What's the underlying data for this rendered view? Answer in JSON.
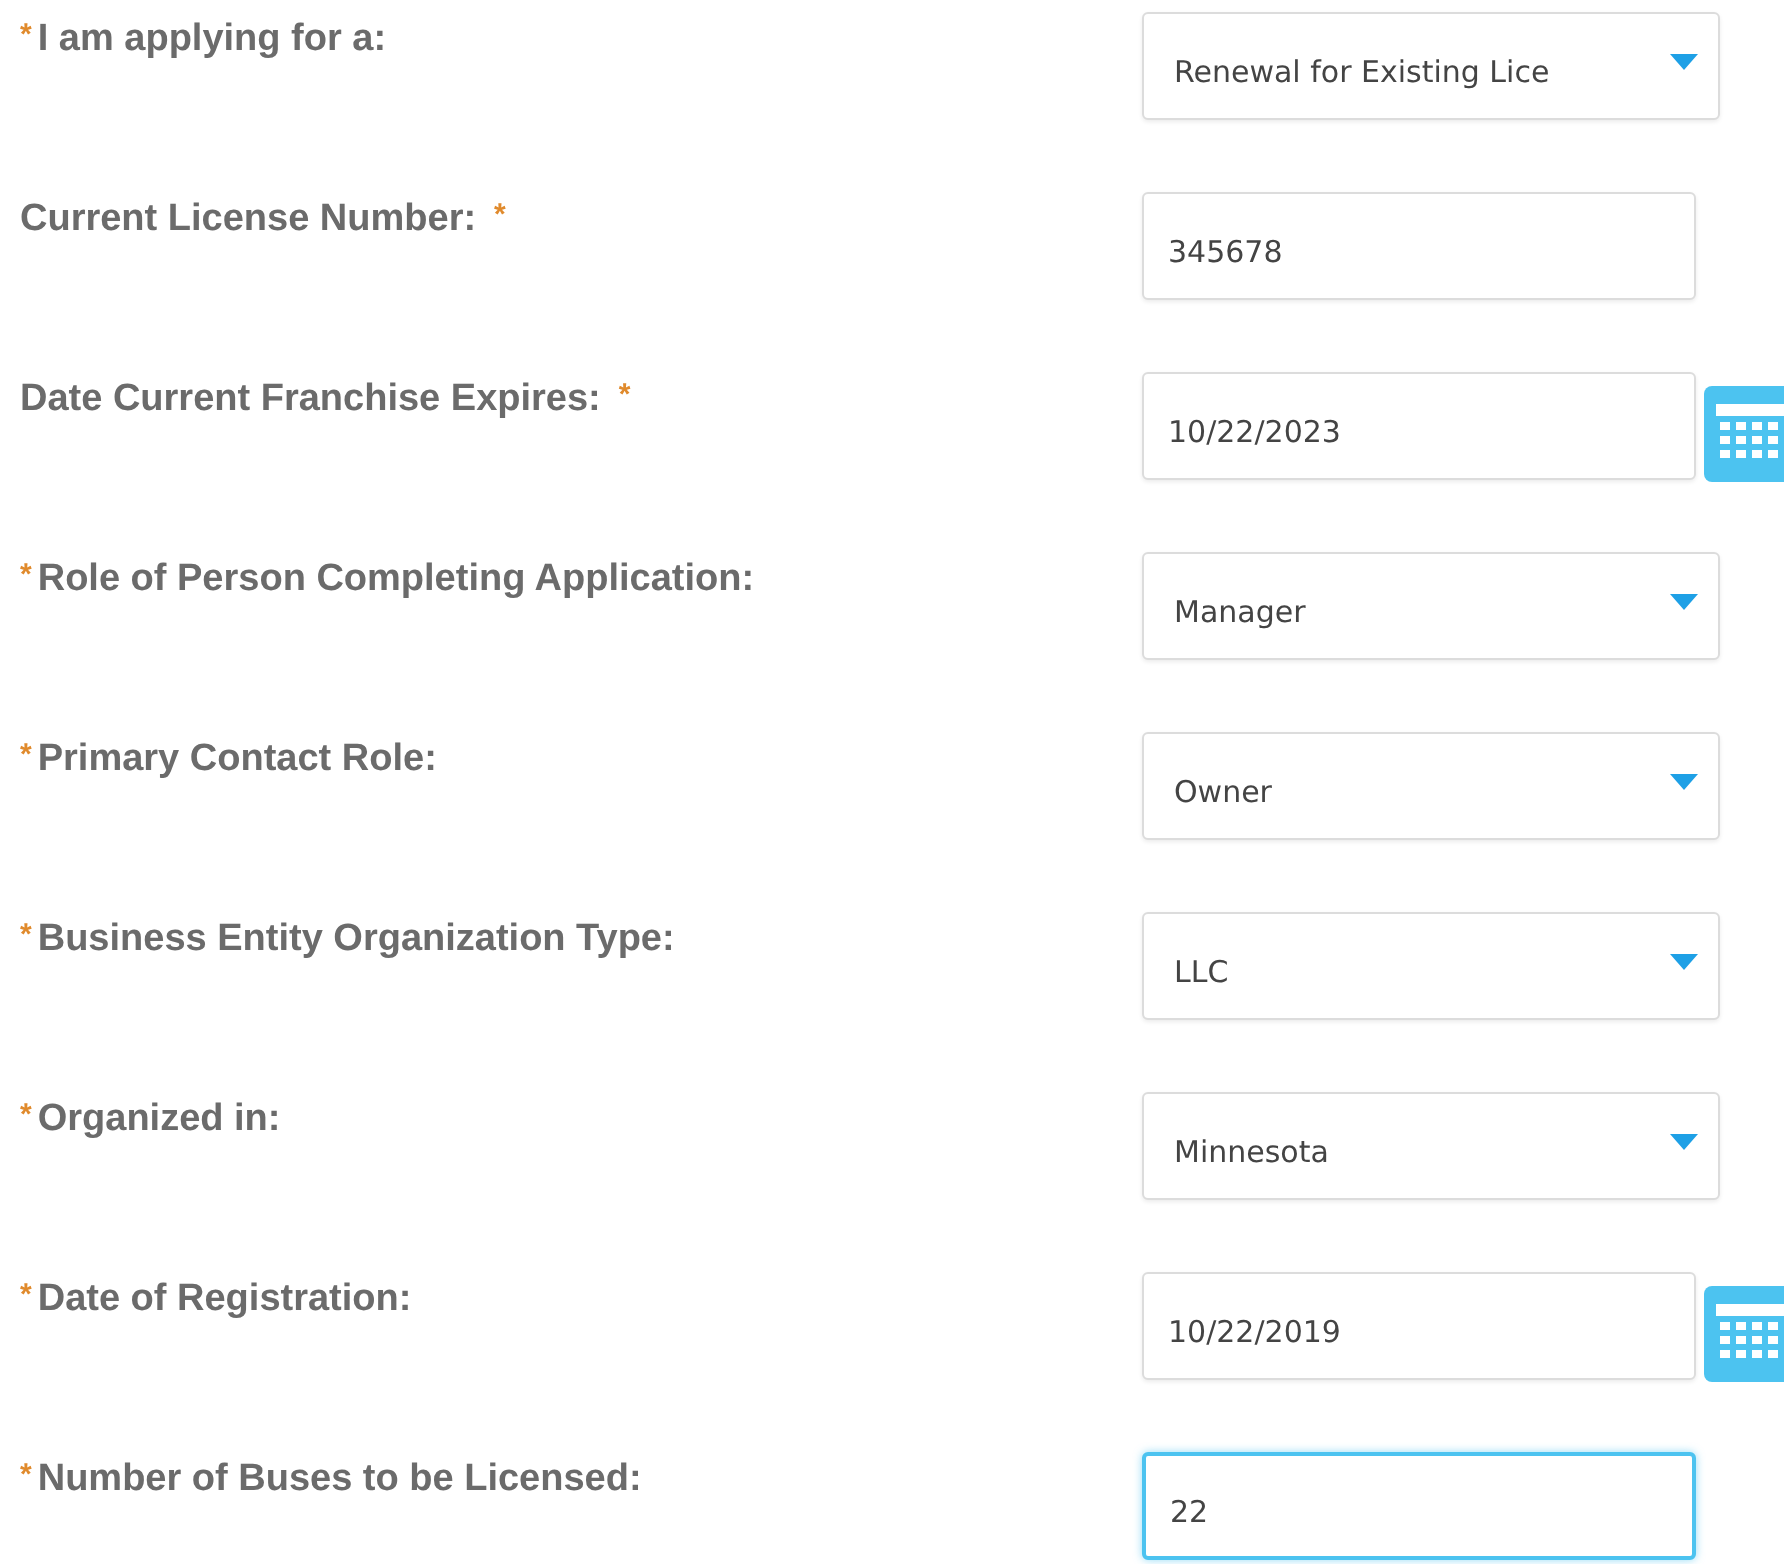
{
  "fields": [
    {
      "label_parts": [
        {
          "kind": "mark",
          "text": "*"
        },
        {
          "kind": "label",
          "text": "I am applying for a:"
        }
      ],
      "kind": "select",
      "value": "Renewal for Existing Lice",
      "focused": false
    },
    {
      "label_parts": [
        {
          "kind": "label",
          "text": "Current License Number:"
        },
        {
          "kind": "mark",
          "text": "*"
        }
      ],
      "kind": "text",
      "value": "345678",
      "focused": false
    },
    {
      "label_parts": [
        {
          "kind": "label",
          "text": "Date Current Franchise Expires:"
        },
        {
          "kind": "mark",
          "text": "*"
        }
      ],
      "kind": "date",
      "value": "10/22/2023",
      "focused": false
    },
    {
      "label_parts": [
        {
          "kind": "mark",
          "text": "*"
        },
        {
          "kind": "label",
          "text": "Role of Person Completing Application:"
        }
      ],
      "kind": "select",
      "value": "Manager",
      "focused": false
    },
    {
      "label_parts": [
        {
          "kind": "mark",
          "text": "*"
        },
        {
          "kind": "label",
          "text": "Primary Contact Role:"
        }
      ],
      "kind": "select",
      "value": "Owner",
      "focused": false
    },
    {
      "label_parts": [
        {
          "kind": "mark",
          "text": "*"
        },
        {
          "kind": "label",
          "text": "Business Entity Organization Type:"
        }
      ],
      "kind": "select",
      "value": "LLC",
      "focused": false
    },
    {
      "label_parts": [
        {
          "kind": "mark",
          "text": "*"
        },
        {
          "kind": "label",
          "text": "Organized in:"
        }
      ],
      "kind": "select",
      "value": "Minnesota",
      "focused": false
    },
    {
      "label_parts": [
        {
          "kind": "mark",
          "text": "*"
        },
        {
          "kind": "label",
          "text": "Date of Registration:"
        }
      ],
      "kind": "date",
      "value": "10/22/2019",
      "focused": false
    },
    {
      "label_parts": [
        {
          "kind": "mark",
          "text": "*"
        },
        {
          "kind": "label",
          "text": "Number of Buses to be Licensed:"
        }
      ],
      "kind": "text",
      "value": "22",
      "focused": true
    }
  ]
}
